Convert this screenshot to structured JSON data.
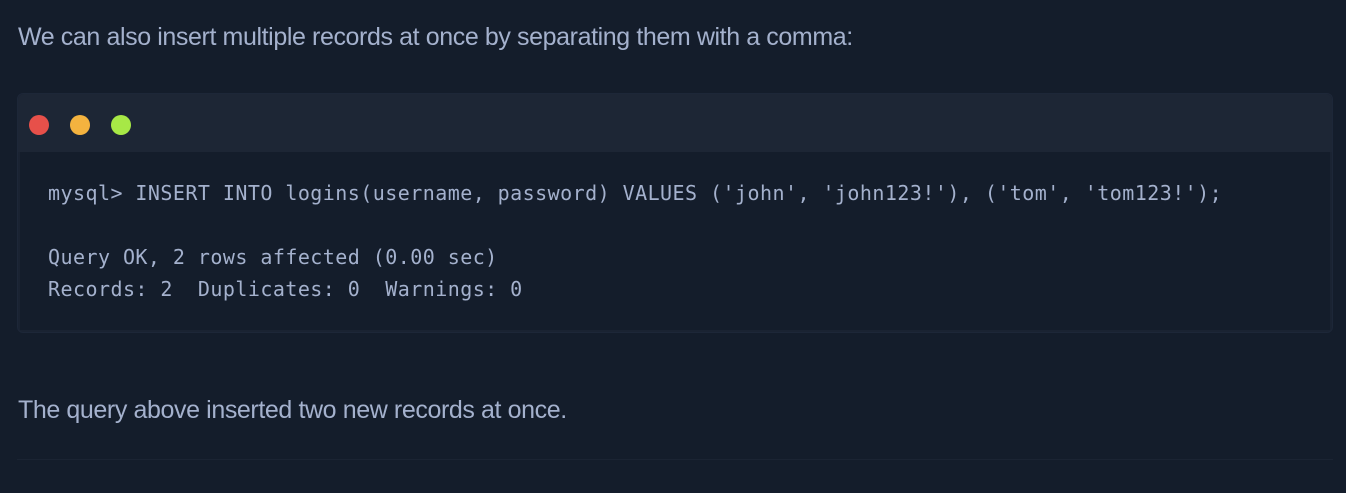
{
  "intro_text": "We can also insert multiple records at once by separating them with a comma:",
  "terminal": {
    "buttons": [
      {
        "name": "close",
        "color": "#e7504a"
      },
      {
        "name": "minimize",
        "color": "#f4b33f"
      },
      {
        "name": "maximize",
        "color": "#a7e846"
      }
    ],
    "lines": [
      "mysql> INSERT INTO logins(username, password) VALUES ('john', 'john123!'), ('tom', 'tom123!');",
      "Query OK, 2 rows affected (0.00 sec)",
      "Records: 2  Duplicates: 0  Warnings: 0"
    ]
  },
  "outro_text": "The query above inserted two new records at once.",
  "colors": {
    "background": "#141d2b",
    "text": "#a4b1cd",
    "terminal_bar": "#1d2635"
  }
}
